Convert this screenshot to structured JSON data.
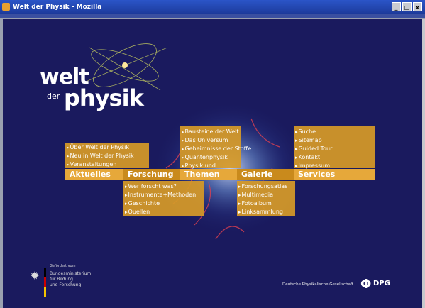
{
  "window": {
    "title": "Welt der Physik - Mozilla",
    "buttons": [
      "_",
      "□",
      "x"
    ]
  },
  "logo": {
    "welt": "welt",
    "der": "der",
    "physik": "physik"
  },
  "menus": {
    "aktuelles": {
      "label": "Aktuelles",
      "items": [
        "Über Welt der Physik",
        "Neu in Welt der Physik",
        "Veranstaltungen"
      ]
    },
    "forschung": {
      "label": "Forschung",
      "items": [
        "Wer forscht was?",
        "Instrumente+Methoden",
        "Geschichte",
        "Quellen"
      ]
    },
    "themen": {
      "label": "Themen",
      "items": [
        "Bausteine der Welt",
        "Das Universum",
        "Geheimnisse der Stoffe",
        "Quantenphysik",
        "Physik und ..."
      ]
    },
    "galerie": {
      "label": "Galerie",
      "items": [
        "Forschungsatlas",
        "Multimedia",
        "Fotoalbum",
        "Linksammlung"
      ]
    },
    "services": {
      "label": "Services",
      "items": [
        "Suche",
        "Sitemap",
        "Guided Tour",
        "Kontakt",
        "Impressum"
      ]
    }
  },
  "footer": {
    "gefoerdert": "Gefördert vom",
    "ministry": [
      "Bundesministerium",
      "für Bildung",
      "und Forschung"
    ],
    "dpg_name": "Deutsche Physikalische Gesellschaft",
    "dpg_abbr": "DPG"
  }
}
